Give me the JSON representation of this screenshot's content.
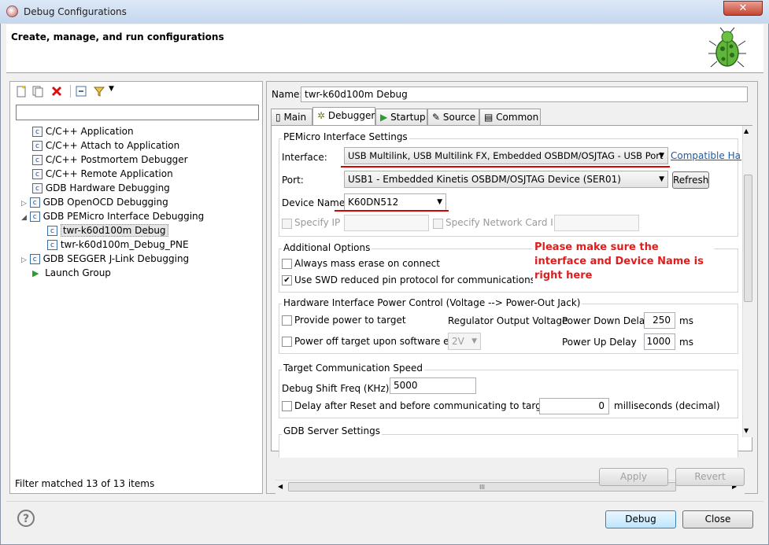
{
  "window": {
    "title": "Debug Configurations",
    "close_glyph": "✕"
  },
  "header": {
    "title": "Create, manage, and run configurations"
  },
  "left": {
    "toolbar": [
      "new-launch-icon",
      "duplicate-icon",
      "delete-icon",
      "collapse-all-icon",
      "filter-icon"
    ],
    "filter_value": "",
    "tree": [
      {
        "label": "C/C++ Application",
        "icon": "c-config-icon"
      },
      {
        "label": "C/C++ Attach to Application",
        "icon": "c-config-icon"
      },
      {
        "label": "C/C++ Postmortem Debugger",
        "icon": "c-config-icon"
      },
      {
        "label": "C/C++ Remote Application",
        "icon": "c-config-icon"
      },
      {
        "label": "GDB Hardware Debugging",
        "icon": "c-config-icon"
      },
      {
        "label": "GDB OpenOCD Debugging",
        "icon": "c-config-icon"
      },
      {
        "label": "GDB PEMicro Interface Debugging",
        "icon": "c-config-icon"
      },
      {
        "label": "twr-k60d100m Debug",
        "icon": "c-config-icon"
      },
      {
        "label": "twr-k60d100m_Debug_PNE",
        "icon": "c-config-icon"
      },
      {
        "label": "GDB SEGGER J-Link Debugging",
        "icon": "c-config-icon"
      },
      {
        "label": "Launch Group",
        "icon": "launch-group-icon"
      }
    ],
    "status": "Filter matched 13 of 13 items"
  },
  "right": {
    "name_label": "Name:",
    "name_value": "twr-k60d100m Debug",
    "tabs": [
      "Main",
      "Debugger",
      "Startup",
      "Source",
      "Common"
    ],
    "pemicro": {
      "title": "PEMicro Interface Settings",
      "interface_label": "Interface:",
      "interface_value": "USB Multilink, USB Multilink FX, Embedded OSBDM/OSJTAG - USB Port",
      "compatible_link": "Compatible Har",
      "port_label": "Port:",
      "port_value": "USB1 - Embedded Kinetis OSBDM/OSJTAG Device (SER01)",
      "refresh": "Refresh",
      "device_label": "Device Name:",
      "device_value": "K60DN512",
      "specify_ip": "Specify IP",
      "specify_nic": "Specify Network Card IP"
    },
    "additional": {
      "title": "Additional Options",
      "mass_erase": "Always mass erase on connect",
      "swd": "Use SWD reduced pin protocol for communications"
    },
    "note": "Please make sure the interface and Device Name is right here",
    "power": {
      "title": "Hardware Interface Power Control (Voltage --> Power-Out Jack)",
      "provide": "Provide power to target",
      "regulator": "Regulator Output Voltage",
      "power_off": "Power off target upon software exit",
      "voltage": "2V",
      "down_label": "Power Down Delay",
      "down_value": "250",
      "up_label": "Power Up Delay",
      "up_value": "1000",
      "ms": "ms"
    },
    "speed": {
      "title": "Target Communication Speed",
      "shift_label": "Debug Shift Freq (KHz)",
      "shift_value": "5000",
      "delay_label": "Delay after Reset and before communicating to target for",
      "delay_value": "0",
      "delay_unit": "milliseconds (decimal)"
    },
    "gdb_title": "GDB Server Settings",
    "scroll_grip": "III",
    "apply": "Apply",
    "revert": "Revert"
  },
  "footer": {
    "debug": "Debug",
    "close": "Close",
    "help": "?"
  }
}
